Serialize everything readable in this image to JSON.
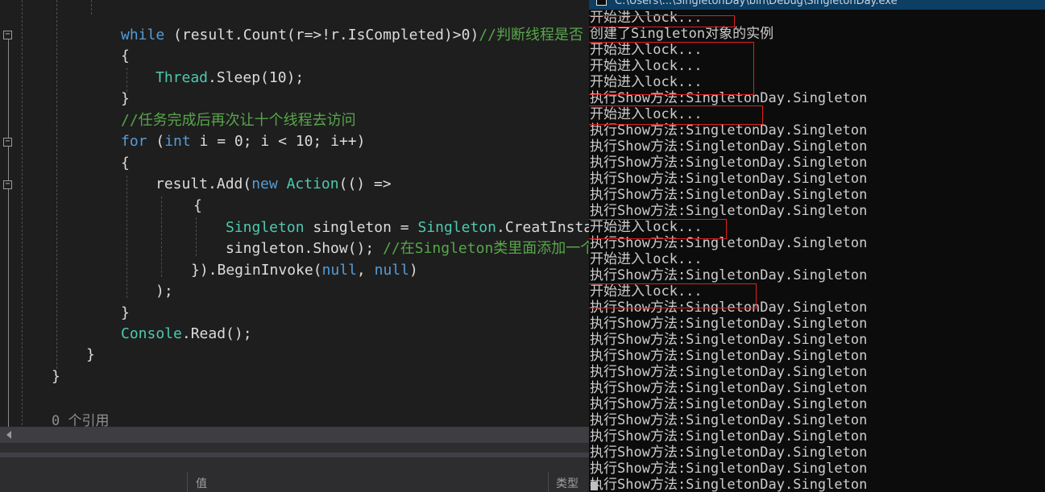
{
  "editor": {
    "lines": [
      [
        {
          "t": "while",
          "c": "kw"
        },
        {
          "t": " (result.Count(r=>!r.IsCompleted)>0)",
          "c": "pl"
        },
        {
          "t": "//判断线程是否",
          "c": "cm"
        }
      ],
      [
        {
          "t": "{",
          "c": "pl"
        }
      ],
      [
        {
          "t": "Thread",
          "c": "ty"
        },
        {
          "t": ".Sleep(10);",
          "c": "pl"
        }
      ],
      [
        {
          "t": "}",
          "c": "pl"
        }
      ],
      [
        {
          "t": "//任务完成后再次让十个线程去访问",
          "c": "cm"
        }
      ],
      [
        {
          "t": "for",
          "c": "kw"
        },
        {
          "t": " (",
          "c": "pl"
        },
        {
          "t": "int",
          "c": "kw"
        },
        {
          "t": " i = 0; i < 10; i++)",
          "c": "pl"
        }
      ],
      [
        {
          "t": "{",
          "c": "pl"
        }
      ],
      [
        {
          "t": "result.Add(",
          "c": "pl"
        },
        {
          "t": "new",
          "c": "kw"
        },
        {
          "t": " ",
          "c": "pl"
        },
        {
          "t": "Action",
          "c": "ty"
        },
        {
          "t": "(() =>",
          "c": "pl"
        }
      ],
      [
        {
          "t": "{",
          "c": "pl"
        }
      ],
      [
        {
          "t": "Singleton",
          "c": "ty"
        },
        {
          "t": " singleton = ",
          "c": "pl"
        },
        {
          "t": "Singleton",
          "c": "ty"
        },
        {
          "t": ".CreatInstance();",
          "c": "pl"
        }
      ],
      [
        {
          "t": "singleton.Show(); ",
          "c": "pl"
        },
        {
          "t": "//在Singleton类里面添加一个",
          "c": "cm"
        }
      ],
      [
        {
          "t": "}).BeginInvoke(",
          "c": "pl"
        },
        {
          "t": "null",
          "c": "kw"
        },
        {
          "t": ", ",
          "c": "pl"
        },
        {
          "t": "null",
          "c": "kw"
        },
        {
          "t": ")",
          "c": "pl"
        }
      ],
      [
        {
          "t": ");",
          "c": "pl"
        }
      ],
      [
        {
          "t": "}",
          "c": "pl"
        }
      ],
      [
        {
          "t": "Console",
          "c": "ty"
        },
        {
          "t": ".Read();",
          "c": "pl"
        }
      ],
      [
        {
          "t": "}",
          "c": "pl"
        }
      ],
      [
        {
          "t": "}",
          "c": "pl"
        }
      ]
    ],
    "codelens": "0 个引用"
  },
  "panel": {
    "col_value": "值",
    "col_type": "类型"
  },
  "console": {
    "title": "C:\\Users\\...\\SingletonDay\\bin\\Debug\\SingletonDay.exe",
    "lines": [
      "开始进入lock...",
      "创建了Singleton对象的实例",
      "开始进入lock...",
      "开始进入lock...",
      "开始进入lock...",
      "执行Show方法:SingletonDay.Singleton",
      "开始进入lock...",
      "执行Show方法:SingletonDay.Singleton",
      "执行Show方法:SingletonDay.Singleton",
      "执行Show方法:SingletonDay.Singleton",
      "执行Show方法:SingletonDay.Singleton",
      "执行Show方法:SingletonDay.Singleton",
      "执行Show方法:SingletonDay.Singleton",
      "开始进入lock...",
      "执行Show方法:SingletonDay.Singleton",
      "开始进入lock...",
      "执行Show方法:SingletonDay.Singleton",
      "开始进入lock...",
      "执行Show方法:SingletonDay.Singleton",
      "执行Show方法:SingletonDay.Singleton",
      "执行Show方法:SingletonDay.Singleton",
      "执行Show方法:SingletonDay.Singleton",
      "执行Show方法:SingletonDay.Singleton",
      "执行Show方法:SingletonDay.Singleton",
      "执行Show方法:SingletonDay.Singleton",
      "执行Show方法:SingletonDay.Singleton",
      "执行Show方法:SingletonDay.Singleton",
      "执行Show方法:SingletonDay.Singleton",
      "执行Show方法:SingletonDay.Singleton",
      "执行Show方法:SingletonDay.Singleton"
    ]
  },
  "colors": {
    "keyword": "#569cd6",
    "type": "#4ec9b0",
    "comment": "#57a64a",
    "highlight_box": "#e02020"
  }
}
